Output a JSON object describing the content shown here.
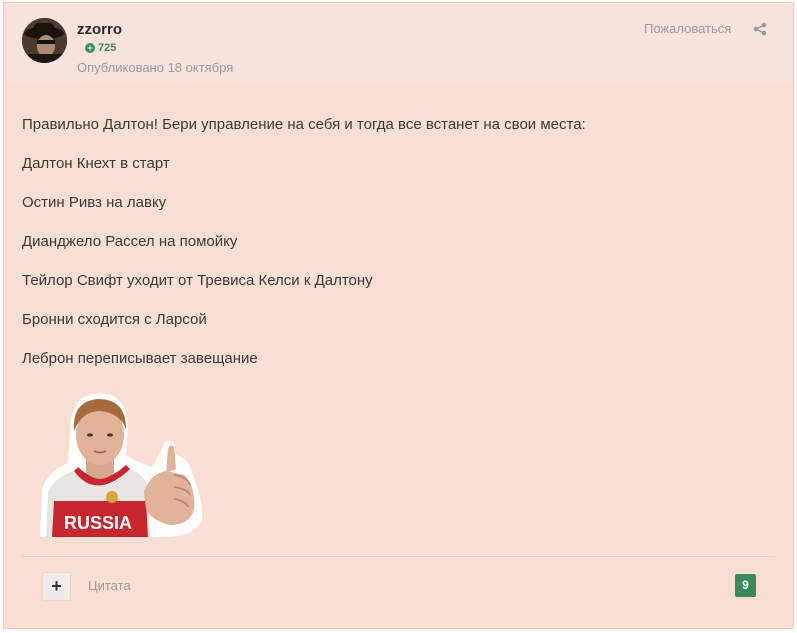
{
  "author": {
    "username": "zzorro",
    "reputation": "725",
    "published": "Опубликовано 18 октября"
  },
  "header_actions": {
    "report_label": "Пожаловаться",
    "share_icon": "share-icon"
  },
  "post": {
    "lines": [
      "Правильно Далтон! Бери управление на себя и тогда все встанет на свои места:",
      "Далтон Кнехт в старт",
      "Остин Ривз на лавку",
      "Дианджело Рассел на помойку",
      "Тейлор Свифт уходит от Тревиса Келси к Далтону",
      "Бронни сходится с Ларсой",
      "Леброн переписывает завещание"
    ],
    "sticker_text": "RUSSIA"
  },
  "footer": {
    "plus_label": "+",
    "quote_label": "Цитата",
    "reaction_count": "9"
  },
  "colors": {
    "post_background": "#f9ded4",
    "accent_green": "#3a8a5a"
  }
}
